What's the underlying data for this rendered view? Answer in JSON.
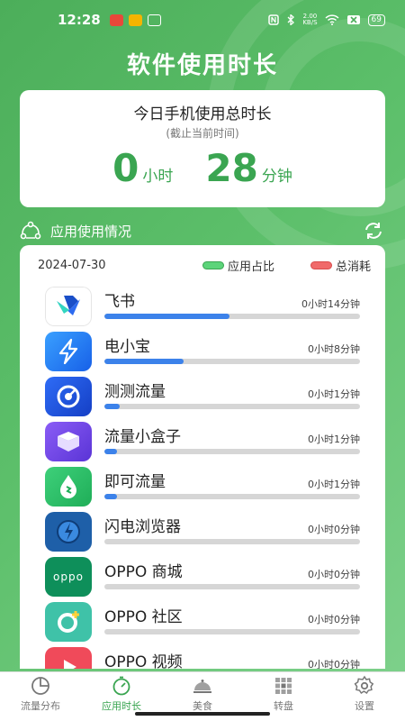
{
  "status_bar": {
    "time": "12:28",
    "speed_value": "2.00",
    "speed_unit": "KB/S",
    "battery": "69"
  },
  "header": {
    "title": "软件使用时长"
  },
  "summary": {
    "title": "今日手机使用总时长",
    "subtitle": "(截止当前时间)",
    "hours": "0",
    "hours_unit": "小时",
    "minutes": "28",
    "minutes_unit": "分钟"
  },
  "section": {
    "label": "应用使用情况"
  },
  "list": {
    "date": "2024-07-30",
    "legend_share": "应用占比",
    "legend_share_color": "#5cd47a",
    "legend_consumption": "总消耗",
    "legend_consumption_color": "#f06a6a",
    "bar_color": "#3c82ea",
    "apps": [
      {
        "name": "飞书",
        "time": "0小时14分钟",
        "share": 0.49,
        "icon": "feishu-icon"
      },
      {
        "name": "电小宝",
        "time": "0小时8分钟",
        "share": 0.31,
        "icon": "lightning-icon"
      },
      {
        "name": "测测流量",
        "time": "0小时1分钟",
        "share": 0.06,
        "icon": "speedtest-icon"
      },
      {
        "name": "流量小盒子",
        "time": "0小时1分钟",
        "share": 0.05,
        "icon": "box-icon"
      },
      {
        "name": "即可流量",
        "time": "0小时1分钟",
        "share": 0.05,
        "icon": "drop-icon"
      },
      {
        "name": "闪电浏览器",
        "time": "0小时0分钟",
        "share": 0,
        "icon": "compass-icon"
      },
      {
        "name": "OPPO 商城",
        "time": "0小时0分钟",
        "share": 0,
        "icon": "oppo-logo-icon"
      },
      {
        "name": "OPPO 社区",
        "time": "0小时0分钟",
        "share": 0,
        "icon": "community-icon"
      },
      {
        "name": "OPPO 视频",
        "time": "0小时0分钟",
        "share": 0,
        "icon": "video-play-icon"
      }
    ]
  },
  "tabbar": {
    "items": [
      {
        "label": "流量分布",
        "icon": "pie-chart-icon"
      },
      {
        "label": "应用时长",
        "icon": "stopwatch-icon"
      },
      {
        "label": "美食",
        "icon": "food-cloche-icon"
      },
      {
        "label": "转盘",
        "icon": "grid-wheel-icon"
      },
      {
        "label": "设置",
        "icon": "gear-icon"
      }
    ],
    "active_color": "#3aa551"
  }
}
